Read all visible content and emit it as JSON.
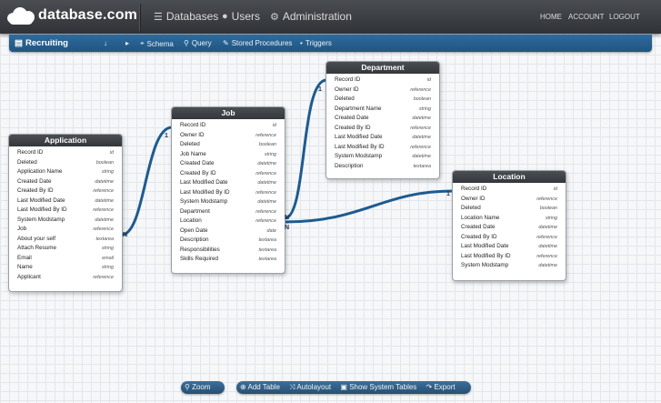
{
  "app": {
    "name": "database.com"
  },
  "nav": {
    "databases": "Databases",
    "users": "Users",
    "administration": "Administration",
    "home": "HOME",
    "account": "ACCOUNT",
    "logout": "LOGOUT"
  },
  "subbar": {
    "app": "Recruiting",
    "schema": "Schema",
    "query": "Query",
    "stored": "Stored Procedures",
    "triggers": "Triggers"
  },
  "tables": [
    {
      "name": "Application",
      "fields": [
        [
          "Record ID",
          "id"
        ],
        [
          "Deleted",
          "boolean"
        ],
        [
          "Application Name",
          "string"
        ],
        [
          "Created Date",
          "datetime"
        ],
        [
          "Created By ID",
          "reference"
        ],
        [
          "Last Modified Date",
          "datetime"
        ],
        [
          "Last Modified By ID",
          "reference"
        ],
        [
          "System Modstamp",
          "datetime"
        ],
        [
          "Job",
          "reference"
        ],
        [
          "About your self",
          "textarea"
        ],
        [
          "Attach Resume",
          "string"
        ],
        [
          "Email",
          "email"
        ],
        [
          "Name",
          "string"
        ],
        [
          "Applicant",
          "reference"
        ]
      ]
    },
    {
      "name": "Job",
      "fields": [
        [
          "Record ID",
          "id"
        ],
        [
          "Owner ID",
          "reference"
        ],
        [
          "Deleted",
          "boolean"
        ],
        [
          "Job Name",
          "string"
        ],
        [
          "Created Date",
          "datetime"
        ],
        [
          "Created By ID",
          "reference"
        ],
        [
          "Last Modified Date",
          "datetime"
        ],
        [
          "Last Modified By ID",
          "reference"
        ],
        [
          "System Modstamp",
          "datetime"
        ],
        [
          "Department",
          "reference"
        ],
        [
          "Location",
          "reference"
        ],
        [
          "Open Date",
          "date"
        ],
        [
          "Description",
          "textarea"
        ],
        [
          "Responsibilities",
          "textarea"
        ],
        [
          "Skills Required",
          "textarea"
        ]
      ]
    },
    {
      "name": "Department",
      "fields": [
        [
          "Record ID",
          "id"
        ],
        [
          "Owner ID",
          "reference"
        ],
        [
          "Deleted",
          "boolean"
        ],
        [
          "Department Name",
          "string"
        ],
        [
          "Created Date",
          "datetime"
        ],
        [
          "Created By ID",
          "reference"
        ],
        [
          "Last Modified Date",
          "datetime"
        ],
        [
          "Last Modified By ID",
          "reference"
        ],
        [
          "System Modstamp",
          "datetime"
        ],
        [
          "Description",
          "textarea"
        ]
      ]
    },
    {
      "name": "Location",
      "fields": [
        [
          "Record ID",
          "id"
        ],
        [
          "Owner ID",
          "reference"
        ],
        [
          "Deleted",
          "boolean"
        ],
        [
          "Location Name",
          "string"
        ],
        [
          "Created Date",
          "datetime"
        ],
        [
          "Created By ID",
          "reference"
        ],
        [
          "Last Modified Date",
          "datetime"
        ],
        [
          "Last Modified By ID",
          "reference"
        ],
        [
          "System Modstamp",
          "datetime"
        ]
      ]
    }
  ],
  "relations": {
    "one": "1",
    "many": "N"
  },
  "toolbar": {
    "zoom": "Zoom",
    "add_table": "Add Table",
    "autolayout": "Autolayout",
    "show_system": "Show System Tables",
    "export": "Export"
  }
}
